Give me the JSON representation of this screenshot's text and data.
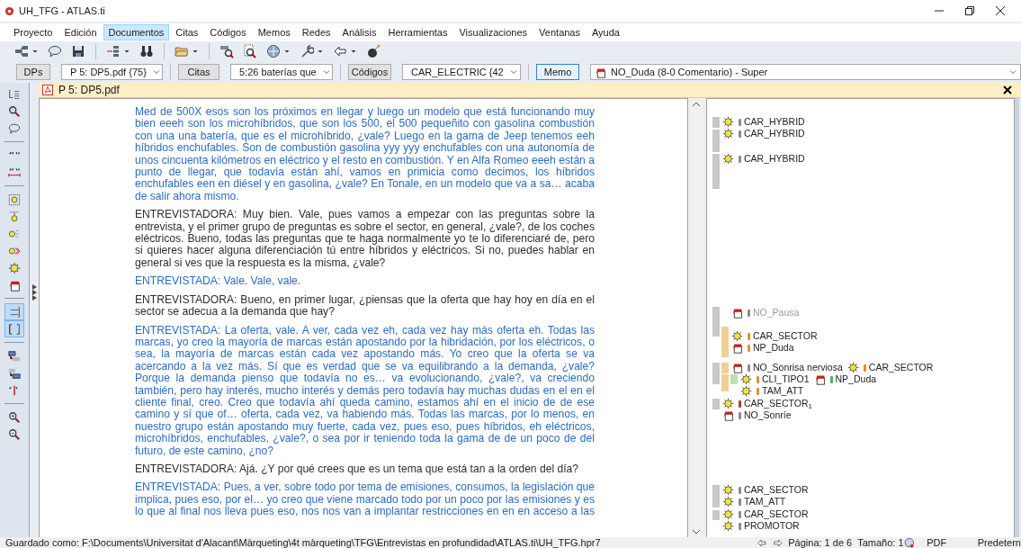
{
  "window": {
    "title": "UH_TFG - ATLAS.ti"
  },
  "menu": [
    {
      "label": "Proyecto",
      "selected": false
    },
    {
      "label": "Edición",
      "selected": false
    },
    {
      "label": "Documentos",
      "selected": true
    },
    {
      "label": "Citas",
      "selected": false
    },
    {
      "label": "Códigos",
      "selected": false
    },
    {
      "label": "Memos",
      "selected": false
    },
    {
      "label": "Redes",
      "selected": false
    },
    {
      "label": "Análisis",
      "selected": false
    },
    {
      "label": "Herramientas",
      "selected": false
    },
    {
      "label": "Visualizaciones",
      "selected": false
    },
    {
      "label": "Ventanas",
      "selected": false
    },
    {
      "label": "Ayuda",
      "selected": false
    }
  ],
  "selectors": [
    {
      "kind": "document",
      "button": "DPs",
      "selected": false,
      "value": "P 5: DP5.pdf {75}"
    },
    {
      "kind": "quotation",
      "button": "Citas",
      "selected": false,
      "value": "5:26 baterías que"
    },
    {
      "kind": "code",
      "button": "Códigos",
      "selected": false,
      "value": "CAR_ELECTRIC {42"
    },
    {
      "kind": "memo",
      "button": "Memo",
      "selected": true,
      "value": "NO_Duda (8-0 Comentario) - Super"
    }
  ],
  "document": {
    "title": "P 5: DP5.pdf",
    "paragraphs": [
      {
        "kind": "interviewee",
        "text": "Med de 500X esos son los próximos en llegar y luego un modelo que está funcionando muy bien eeeh son los microhíbridos, que son los 500, el 500 pequeñito con gasolina combustión con una una batería, que es el microhíbrido, ¿vale? Luego en la gama de Jeep tenemos eeh híbridos enchufables. Son de combustión gasolina yyy yyy enchufables con una autonomía de unos cincuenta kilómetros en eléctrico y el resto en combustión. Y en Alfa Romeo eeeh están a punto de llegar, que todavía están ahí, vamos en primicia como decimos, los híbridos enchufables een en diésel y en gasolina, ¿vale? En Tonale, en un modelo que va a sa… acaba de salir ahora mismo."
      },
      {
        "kind": "interviewer",
        "text": "ENTREVISTADORA: Muy bien. Vale, pues vamos a empezar con las preguntas sobre la entrevista, y el primer grupo de preguntas es sobre el sector, en general, ¿vale?, de los coches eléctricos. Bueno, todas las preguntas que te haga normalmente yo te lo diferenciaré de, pero si quieres hacer alguna diferenciación tú entre híbridos y eléctricos. Si no, puedes hablar en general si ves que la respuesta es la misma, ¿vale?"
      },
      {
        "kind": "interviewee",
        "text": "ENTREVISTADA: Vale. Vale, vale."
      },
      {
        "kind": "interviewer",
        "text": "ENTREVISTADORA: Bueno, en primer lugar, ¿piensas que la oferta que hay hoy en día en el sector se adecua a la demanda que hay?"
      },
      {
        "kind": "interviewee",
        "text": "ENTREVISTADA: La oferta, vale. A ver, cada vez eh, cada vez hay más oferta eh. Todas las marcas, yo creo la mayoría de marcas están apostando por la hibridación, por los eléctricos, o sea, la mayoría de marcas están cada vez apostando más. Yo creo que la oferta se va acercando a la vez más. Sí que es verdad que se va equilibrando a la demanda, ¿vale? Porque la demanda pienso que todavía no es… va evolucionando, ¿vale?, va creciendo también, pero hay interés, mucho interés y demás pero todavía hay muchas dudas en el en el cliente final, creo. Creo que todavía ahí queda camino, estamos ahí en el inicio de de ese camino y sí que of… oferta, cada vez, va habiendo más. Todas las marcas, por lo menos, en nuestro grupo están apostando muy fuerte, cada vez, pues eso, pues híbridos, eh eléctricos, microhíbridos, enchufables, ¿vale?, o sea por ir teniendo toda la gama de de un poco de del futuro, de este camino, ¿no?"
      },
      {
        "kind": "interviewer",
        "text": "ENTREVISTADORA: Ajá. ¿Y por qué crees que es un tema que está tan a la orden del día?"
      },
      {
        "kind": "interviewee",
        "text": "ENTREVISTADA: Pues, a ver, sobre todo por tema de emisiones, consumos, la legislación que implica, pues eso, por el… yo creo que viene marcado todo por un poco por las emisiones y es lo que al final nos lleva pues eso, nos nos van a implantar restricciones en en en acceso a las"
      }
    ]
  },
  "margin": [
    {
      "items": [
        {
          "kind": "code",
          "label": "CAR_HYBRID",
          "color": "#8c8c8c",
          "dimmed": false
        }
      ]
    },
    {
      "items": [
        {
          "kind": "code",
          "label": "CAR_HYBRID",
          "color": "#8c8c8c",
          "dimmed": false
        }
      ]
    },
    {
      "items": [
        {
          "kind": "code",
          "label": "CAR_HYBRID",
          "color": "#8c8c8c",
          "dimmed": false
        }
      ]
    },
    {
      "items": [
        {
          "kind": "memo",
          "label": "NO_Pausa",
          "color": "#8c8c8c",
          "dimmed": true
        }
      ]
    },
    {
      "items": [
        {
          "kind": "code",
          "label": "CAR_SECTOR",
          "color": "#d9952e",
          "dimmed": false
        }
      ]
    },
    {
      "items": [
        {
          "kind": "memo",
          "label": "NP_Duda",
          "color": "#d9952e",
          "dimmed": false
        }
      ]
    },
    {
      "items": [
        {
          "kind": "memo",
          "label": "NO_Sonrisa nerviosa",
          "color": "#8c8c8c",
          "dimmed": false
        },
        {
          "kind": "code",
          "label": "CAR_SECTOR",
          "color": "#d9952e",
          "dimmed": false
        }
      ]
    },
    {
      "items": [
        {
          "kind": "code",
          "label": "CLI_TIPO1",
          "color": "#d9952e",
          "dimmed": false
        },
        {
          "kind": "memo",
          "label": "NP_Duda",
          "color": "#5aa85e",
          "dimmed": false
        }
      ]
    },
    {
      "items": [
        {
          "kind": "code",
          "label": "TAM_ATT",
          "color": "#d9952e",
          "dimmed": false
        }
      ]
    },
    {
      "items": [
        {
          "kind": "code",
          "label": "CAR_SECTOR$_{1}$",
          "color": "#c0392b",
          "dimmed": false
        }
      ]
    },
    {
      "items": [
        {
          "kind": "memo",
          "label": "NO_Sonríe",
          "color": "#8c8c8c",
          "dimmed": false
        }
      ]
    },
    {
      "items": [
        {
          "kind": "code",
          "label": "CAR_SECTOR",
          "color": "#8c8c8c",
          "dimmed": false
        }
      ]
    },
    {
      "items": [
        {
          "kind": "code",
          "label": "TAM_ATT",
          "color": "#8c8c8c",
          "dimmed": false
        }
      ]
    },
    {
      "items": [
        {
          "kind": "code",
          "label": "CAR_SECTOR",
          "color": "#8c8c8c",
          "dimmed": false
        }
      ]
    },
    {
      "items": [
        {
          "kind": "code",
          "label": "PROMOTOR",
          "color": "#8c8c8c",
          "dimmed": false
        }
      ]
    }
  ],
  "status_bar": {
    "path": "Guardado como: F:\\Documents\\Universitat d'Alacant\\Màrqueting\\4t màrqueting\\TFG\\Entrevistas en profundidad\\ATLAS.ti\\UH_TFG.hpr7",
    "page": "Página: 1 de 6",
    "size": "Tamaño: 1",
    "format": "PDF",
    "mode": "Predetern"
  }
}
